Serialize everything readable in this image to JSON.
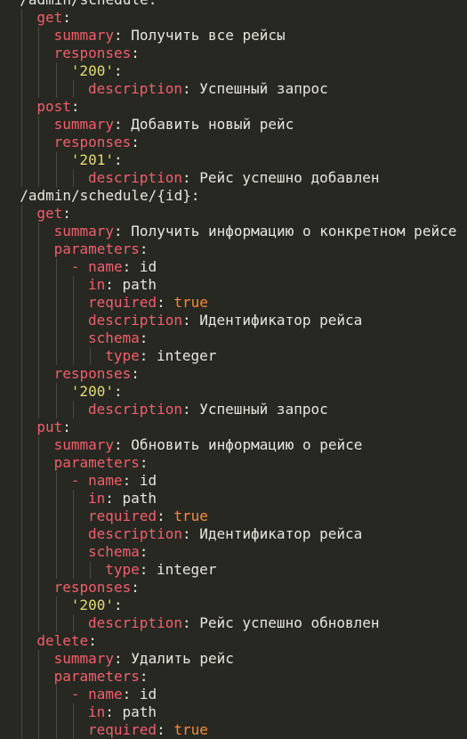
{
  "editor": {
    "language": "yaml",
    "colors": {
      "background": "#272822",
      "key": "#f15f6b",
      "text": "#e8e6dc",
      "string": "#e6db74",
      "boolean": "#f48b43",
      "indent_guide": "#4a4a42"
    },
    "lines": [
      {
        "indent": 2,
        "parts": [
          {
            "t": "/admin/schedule",
            "c": "text"
          },
          {
            "t": ":",
            "c": "punct"
          },
          {
            "t": " ",
            "c": "text"
          },
          {
            "t": "—",
            "c": "text"
          }
        ]
      },
      {
        "indent": 2,
        "parts": [
          {
            "t": "/admin/schedule",
            "c": "text"
          },
          {
            "t": ":",
            "c": "punct"
          }
        ]
      },
      {
        "indent": 4,
        "parts": [
          {
            "t": "get",
            "c": "key"
          },
          {
            "t": ":",
            "c": "punct"
          }
        ]
      },
      {
        "indent": 6,
        "parts": [
          {
            "t": "summary",
            "c": "key"
          },
          {
            "t": ": ",
            "c": "punct"
          },
          {
            "t": "Получить все рейсы",
            "c": "text"
          }
        ]
      },
      {
        "indent": 6,
        "parts": [
          {
            "t": "responses",
            "c": "key"
          },
          {
            "t": ":",
            "c": "punct"
          }
        ]
      },
      {
        "indent": 8,
        "parts": [
          {
            "t": "'200'",
            "c": "str"
          },
          {
            "t": ":",
            "c": "punct"
          }
        ]
      },
      {
        "indent": 10,
        "parts": [
          {
            "t": "description",
            "c": "key"
          },
          {
            "t": ": ",
            "c": "punct"
          },
          {
            "t": "Успешный запрос",
            "c": "text"
          }
        ]
      },
      {
        "indent": 4,
        "parts": [
          {
            "t": "post",
            "c": "key"
          },
          {
            "t": ":",
            "c": "punct"
          }
        ]
      },
      {
        "indent": 6,
        "parts": [
          {
            "t": "summary",
            "c": "key"
          },
          {
            "t": ": ",
            "c": "punct"
          },
          {
            "t": "Добавить новый рейс",
            "c": "text"
          }
        ]
      },
      {
        "indent": 6,
        "parts": [
          {
            "t": "responses",
            "c": "key"
          },
          {
            "t": ":",
            "c": "punct"
          }
        ]
      },
      {
        "indent": 8,
        "parts": [
          {
            "t": "'201'",
            "c": "str"
          },
          {
            "t": ":",
            "c": "punct"
          }
        ]
      },
      {
        "indent": 10,
        "parts": [
          {
            "t": "description",
            "c": "key"
          },
          {
            "t": ": ",
            "c": "punct"
          },
          {
            "t": "Рейс успешно добавлен",
            "c": "text"
          }
        ]
      },
      {
        "indent": 2,
        "parts": [
          {
            "t": "/admin/schedule/{id}",
            "c": "text"
          },
          {
            "t": ":",
            "c": "punct"
          }
        ]
      },
      {
        "indent": 4,
        "parts": [
          {
            "t": "get",
            "c": "key"
          },
          {
            "t": ":",
            "c": "punct"
          }
        ]
      },
      {
        "indent": 6,
        "parts": [
          {
            "t": "summary",
            "c": "key"
          },
          {
            "t": ": ",
            "c": "punct"
          },
          {
            "t": "Получить информацию о конкретном рейсе",
            "c": "text"
          }
        ]
      },
      {
        "indent": 6,
        "parts": [
          {
            "t": "parameters",
            "c": "key"
          },
          {
            "t": ":",
            "c": "punct"
          }
        ]
      },
      {
        "indent": 8,
        "parts": [
          {
            "t": "- ",
            "c": "dash"
          },
          {
            "t": "name",
            "c": "key"
          },
          {
            "t": ": ",
            "c": "punct"
          },
          {
            "t": "id",
            "c": "text"
          }
        ]
      },
      {
        "indent": 10,
        "parts": [
          {
            "t": "in",
            "c": "key"
          },
          {
            "t": ": ",
            "c": "punct"
          },
          {
            "t": "path",
            "c": "text"
          }
        ]
      },
      {
        "indent": 10,
        "parts": [
          {
            "t": "required",
            "c": "key"
          },
          {
            "t": ": ",
            "c": "punct"
          },
          {
            "t": "true",
            "c": "bool"
          }
        ]
      },
      {
        "indent": 10,
        "parts": [
          {
            "t": "description",
            "c": "key"
          },
          {
            "t": ": ",
            "c": "punct"
          },
          {
            "t": "Идентификатор рейса",
            "c": "text"
          }
        ]
      },
      {
        "indent": 10,
        "parts": [
          {
            "t": "schema",
            "c": "key"
          },
          {
            "t": ":",
            "c": "punct"
          }
        ]
      },
      {
        "indent": 12,
        "parts": [
          {
            "t": "type",
            "c": "key"
          },
          {
            "t": ": ",
            "c": "punct"
          },
          {
            "t": "integer",
            "c": "text"
          }
        ]
      },
      {
        "indent": 6,
        "parts": [
          {
            "t": "responses",
            "c": "key"
          },
          {
            "t": ":",
            "c": "punct"
          }
        ]
      },
      {
        "indent": 8,
        "parts": [
          {
            "t": "'200'",
            "c": "str"
          },
          {
            "t": ":",
            "c": "punct"
          }
        ]
      },
      {
        "indent": 10,
        "parts": [
          {
            "t": "description",
            "c": "key"
          },
          {
            "t": ": ",
            "c": "punct"
          },
          {
            "t": "Успешный запрос",
            "c": "text"
          }
        ]
      },
      {
        "indent": 4,
        "parts": [
          {
            "t": "put",
            "c": "key"
          },
          {
            "t": ":",
            "c": "punct"
          }
        ]
      },
      {
        "indent": 6,
        "parts": [
          {
            "t": "summary",
            "c": "key"
          },
          {
            "t": ": ",
            "c": "punct"
          },
          {
            "t": "Обновить информацию о рейсе",
            "c": "text"
          }
        ]
      },
      {
        "indent": 6,
        "parts": [
          {
            "t": "parameters",
            "c": "key"
          },
          {
            "t": ":",
            "c": "punct"
          }
        ]
      },
      {
        "indent": 8,
        "parts": [
          {
            "t": "- ",
            "c": "dash"
          },
          {
            "t": "name",
            "c": "key"
          },
          {
            "t": ": ",
            "c": "punct"
          },
          {
            "t": "id",
            "c": "text"
          }
        ]
      },
      {
        "indent": 10,
        "parts": [
          {
            "t": "in",
            "c": "key"
          },
          {
            "t": ": ",
            "c": "punct"
          },
          {
            "t": "path",
            "c": "text"
          }
        ]
      },
      {
        "indent": 10,
        "parts": [
          {
            "t": "required",
            "c": "key"
          },
          {
            "t": ": ",
            "c": "punct"
          },
          {
            "t": "true",
            "c": "bool"
          }
        ]
      },
      {
        "indent": 10,
        "parts": [
          {
            "t": "description",
            "c": "key"
          },
          {
            "t": ": ",
            "c": "punct"
          },
          {
            "t": "Идентификатор рейса",
            "c": "text"
          }
        ]
      },
      {
        "indent": 10,
        "parts": [
          {
            "t": "schema",
            "c": "key"
          },
          {
            "t": ":",
            "c": "punct"
          }
        ]
      },
      {
        "indent": 12,
        "parts": [
          {
            "t": "type",
            "c": "key"
          },
          {
            "t": ": ",
            "c": "punct"
          },
          {
            "t": "integer",
            "c": "text"
          }
        ]
      },
      {
        "indent": 6,
        "parts": [
          {
            "t": "responses",
            "c": "key"
          },
          {
            "t": ":",
            "c": "punct"
          }
        ]
      },
      {
        "indent": 8,
        "parts": [
          {
            "t": "'200'",
            "c": "str"
          },
          {
            "t": ":",
            "c": "punct"
          }
        ]
      },
      {
        "indent": 10,
        "parts": [
          {
            "t": "description",
            "c": "key"
          },
          {
            "t": ": ",
            "c": "punct"
          },
          {
            "t": "Рейс успешно обновлен",
            "c": "text"
          }
        ]
      },
      {
        "indent": 4,
        "parts": [
          {
            "t": "delete",
            "c": "key"
          },
          {
            "t": ":",
            "c": "punct"
          }
        ]
      },
      {
        "indent": 6,
        "parts": [
          {
            "t": "summary",
            "c": "key"
          },
          {
            "t": ": ",
            "c": "punct"
          },
          {
            "t": "Удалить рейс",
            "c": "text"
          }
        ]
      },
      {
        "indent": 6,
        "parts": [
          {
            "t": "parameters",
            "c": "key"
          },
          {
            "t": ":",
            "c": "punct"
          }
        ]
      },
      {
        "indent": 8,
        "parts": [
          {
            "t": "- ",
            "c": "dash"
          },
          {
            "t": "name",
            "c": "key"
          },
          {
            "t": ": ",
            "c": "punct"
          },
          {
            "t": "id",
            "c": "text"
          }
        ]
      },
      {
        "indent": 10,
        "parts": [
          {
            "t": "in",
            "c": "key"
          },
          {
            "t": ": ",
            "c": "punct"
          },
          {
            "t": "path",
            "c": "text"
          }
        ]
      },
      {
        "indent": 10,
        "parts": [
          {
            "t": "required",
            "c": "key"
          },
          {
            "t": ": ",
            "c": "punct"
          },
          {
            "t": "true",
            "c": "bool"
          }
        ]
      }
    ]
  }
}
